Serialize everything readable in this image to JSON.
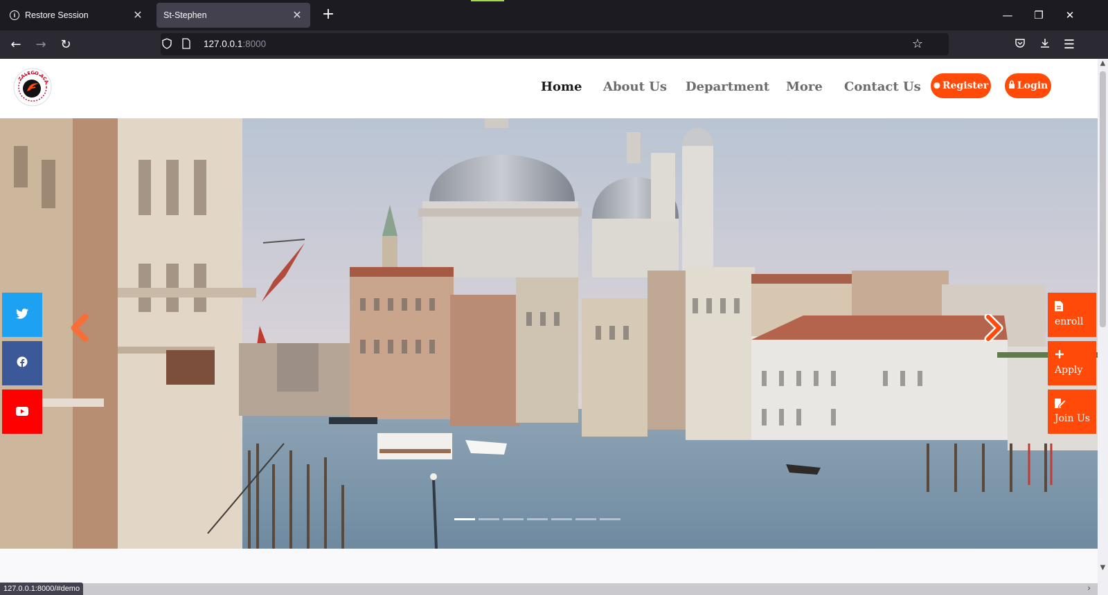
{
  "browser": {
    "tabs": [
      {
        "label": "Restore Session",
        "active": false
      },
      {
        "label": "St-Stephen",
        "active": true
      }
    ],
    "url_host": "127.0.0.1",
    "url_port": ":8000",
    "status_url": "127.0.0.1:8000/#demo"
  },
  "site": {
    "logo_text": "ZALEGO ACADEMY",
    "nav": [
      {
        "label": "Home",
        "active": true
      },
      {
        "label": "About Us",
        "active": false
      },
      {
        "label": "Department",
        "active": false
      },
      {
        "label": "More",
        "active": false
      },
      {
        "label": "Contact Us",
        "active": false
      }
    ],
    "register_label": "Register",
    "login_label": "Login",
    "accent_color": "#ff4a0a",
    "social": [
      {
        "name": "twitter-icon",
        "color": "#1da1f2"
      },
      {
        "name": "facebook-icon",
        "color": "#3b5998"
      },
      {
        "name": "youtube-icon",
        "color": "#ff0000"
      }
    ],
    "side_ctas": [
      {
        "label": "enroll",
        "icon": "file-icon"
      },
      {
        "label": "Apply",
        "icon": "plus-icon"
      },
      {
        "label": "Join Us",
        "icon": "edit-icon"
      }
    ],
    "carousel": {
      "slide_count": 7,
      "active_slide": 1
    }
  }
}
